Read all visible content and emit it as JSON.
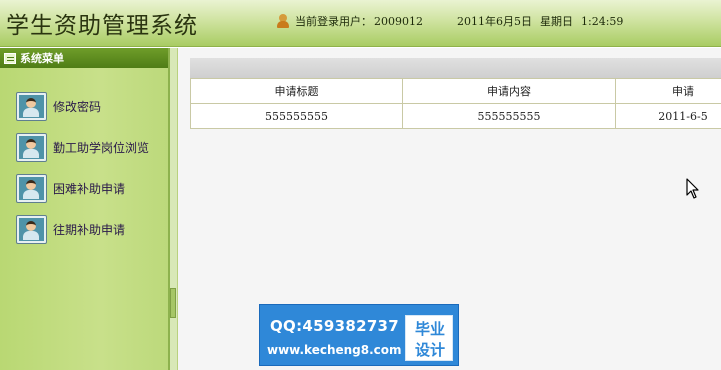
{
  "header": {
    "title": "学生资助管理系统",
    "user_icon": "user-icon",
    "login_label": "当前登录用户：",
    "user_id": "2009012",
    "date": "2011年6月5日",
    "weekday": "星期日",
    "time": "1:24:59"
  },
  "sidebar": {
    "title": "系统菜单",
    "title_icon": "menu-edit-icon",
    "items": [
      {
        "label": "修改密码",
        "icon": "user-card-icon"
      },
      {
        "label": "勤工助学岗位浏览",
        "icon": "user-card-icon"
      },
      {
        "label": "困难补助申请",
        "icon": "user-card-icon"
      },
      {
        "label": "往期补助申请",
        "icon": "user-card-icon"
      }
    ]
  },
  "table": {
    "columns": [
      "申请标题",
      "申请内容",
      "申请"
    ],
    "rows": [
      [
        "555555555",
        "555555555",
        "2011-6-5"
      ]
    ]
  },
  "watermark": {
    "qq": "QQ:459382737",
    "site": "www.kecheng8.com",
    "badge_line1": "毕业",
    "badge_line2": "设计"
  },
  "colors": {
    "header_green": "#a9cc63",
    "sidebar_green": "#c8e08a",
    "sidebar_header": "#4f7d16",
    "table_border": "#c9c9a5",
    "watermark_blue": "#2f88d8"
  }
}
